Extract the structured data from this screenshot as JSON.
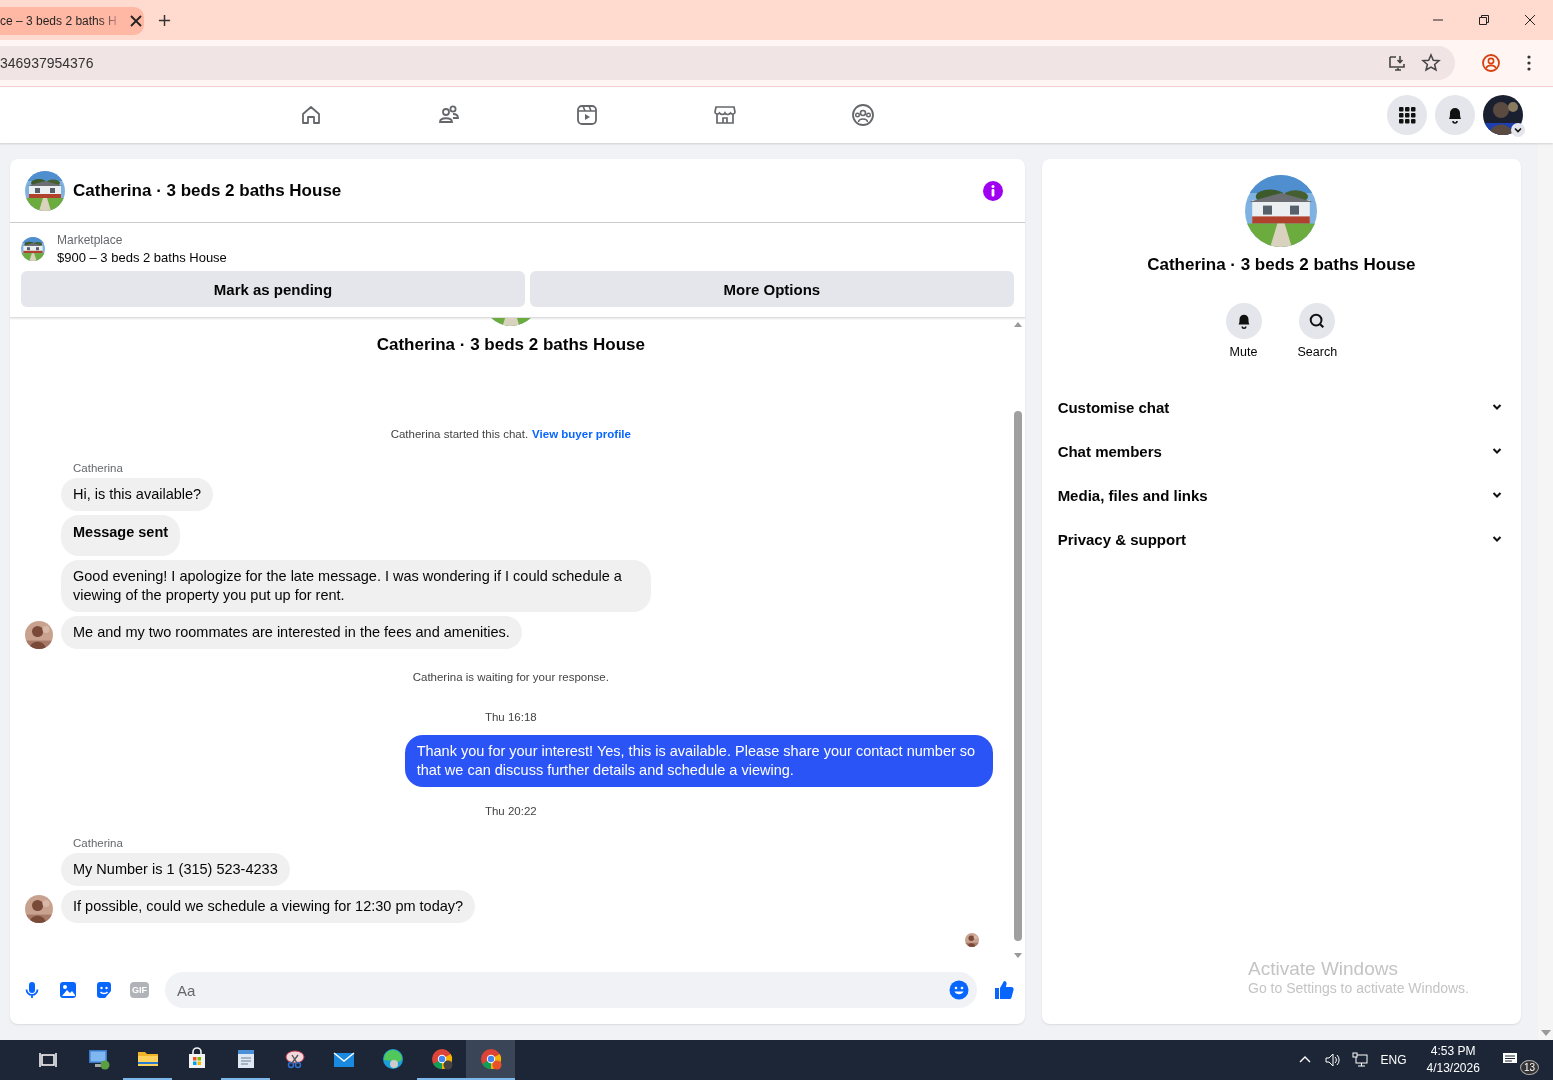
{
  "browser": {
    "tab_title": "ce – 3 beds 2 baths H",
    "address": "346937954376"
  },
  "nav": [
    {
      "kind": "home"
    },
    {
      "kind": "friends"
    },
    {
      "kind": "video"
    },
    {
      "kind": "marketplace"
    },
    {
      "kind": "groups"
    }
  ],
  "chat": {
    "title": "Catherina · 3 beds 2 baths House",
    "listing": {
      "label": "Marketplace",
      "item": "$900 – 3 beds 2 baths House"
    },
    "actions": [
      "Mark as pending",
      "More Options"
    ],
    "thread_title": "Catherina · 3 beds 2 baths House",
    "messages": [
      {
        "kind": "note",
        "text": "Catherina started this chat.",
        "link": "View buyer profile"
      },
      {
        "kind": "sender",
        "text": "Catherina"
      },
      {
        "kind": "in",
        "text": "Hi, is this available?",
        "avatar": false
      },
      {
        "kind": "in",
        "text": "Message sent",
        "avatar": false,
        "bold": true
      },
      {
        "kind": "in",
        "text": "Good evening! I apologize for the late message. I was wondering if I could schedule a viewing of the property you put up for rent.",
        "avatar": false
      },
      {
        "kind": "in",
        "text": "Me and my two roommates are interested in the fees and amenities.",
        "avatar": true
      },
      {
        "kind": "note",
        "text": "Catherina is waiting for your response."
      },
      {
        "kind": "time",
        "text": "Thu 16:18"
      },
      {
        "kind": "out",
        "text": "Thank you for your interest! Yes, this is available. Please share your contact number so that we can discuss further details and schedule a viewing."
      },
      {
        "kind": "time",
        "text": "Thu 20:22"
      },
      {
        "kind": "sender",
        "text": "Catherina"
      },
      {
        "kind": "in",
        "text": "My Number is 1 (315) 523-4233",
        "avatar": false
      },
      {
        "kind": "in",
        "text": "If possible, could we schedule a viewing for 12:30 pm today?",
        "avatar": true
      }
    ],
    "composer": {
      "gif_label": "GIF",
      "placeholder": "Aa"
    }
  },
  "details": {
    "title": "Catherina · 3 beds 2 baths House",
    "actions": [
      {
        "kind": "mute",
        "label": "Mute"
      },
      {
        "kind": "search",
        "label": "Search"
      }
    ],
    "sections": [
      {
        "label": "Customise chat",
        "expanded": false
      },
      {
        "label": "Chat members",
        "expanded": false
      },
      {
        "label": "Media, files and links",
        "expanded": false
      },
      {
        "label": "Privacy & support",
        "expanded": false
      }
    ]
  },
  "activation": {
    "title": "Activate Windows",
    "text": "Go to Settings to activate Windows."
  },
  "taskbar": {
    "apps": [
      {
        "kind": "remote",
        "running": false,
        "selected": false
      },
      {
        "kind": "folder",
        "running": true,
        "selected": false
      },
      {
        "kind": "store",
        "running": false,
        "selected": false
      },
      {
        "kind": "notepad",
        "running": true,
        "selected": false
      },
      {
        "kind": "snip",
        "running": false,
        "selected": false
      },
      {
        "kind": "mail",
        "running": false,
        "selected": false
      },
      {
        "kind": "edge",
        "running": false,
        "selected": false
      },
      {
        "kind": "chrome",
        "running": true,
        "selected": false
      },
      {
        "kind": "chrome2",
        "running": true,
        "selected": true
      }
    ],
    "language": "ENG",
    "time": "4:53 PM",
    "date": "4/13/2026",
    "notifications": "13"
  }
}
